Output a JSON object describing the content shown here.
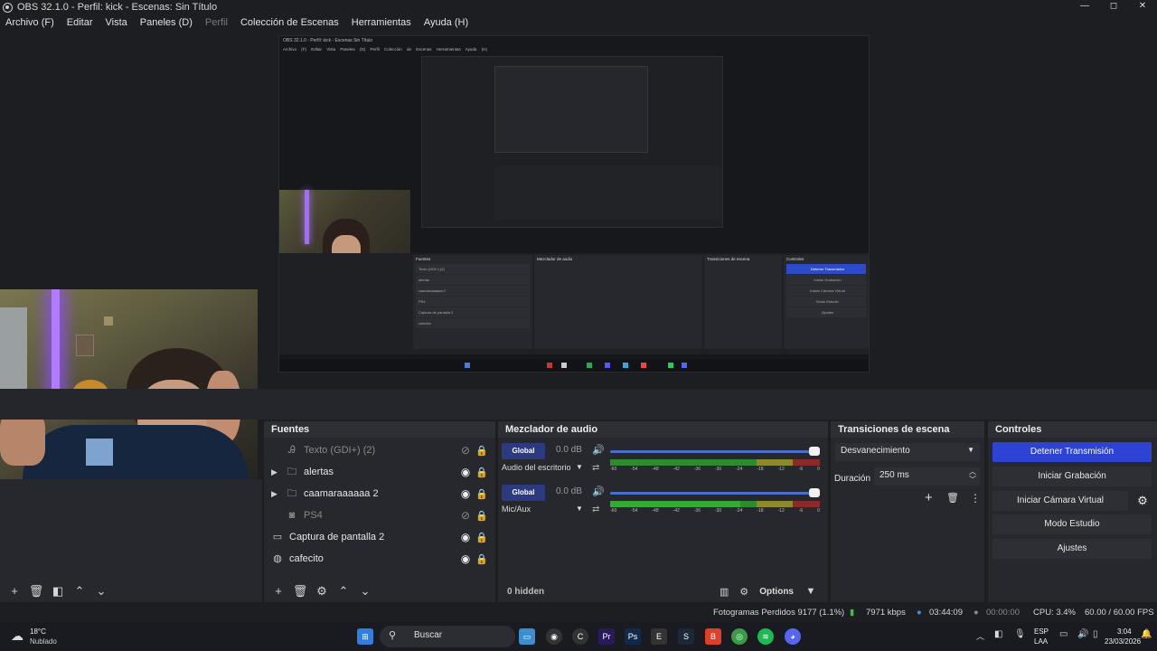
{
  "window": {
    "title": "OBS 32.1.0 - Perfil: kick - Escenas: Sin Título",
    "minimize": "—",
    "maximize": "◻",
    "close": "✕"
  },
  "menu": [
    "Archivo (F)",
    "Editar",
    "Vista",
    "Paneles (D)",
    "Perfil",
    "Colección de Escenas",
    "Herramientas",
    "Ayuda (H)"
  ],
  "nested": {
    "title": "OBS 32.1.0 - Perfil: kick - Escenas Sin Título",
    "menu": "Archivo (F)  Editar  Vista  Paneles (D)  Perfil  Colección de Escenas  Herramientas  Ayuda (H)",
    "docks": {
      "sources_title": "Fuentes",
      "mixer_title": "Mezclador de audio",
      "trans_title": "Transiciones de escena",
      "controls_title": "Controles",
      "sources": [
        "Texto (GDI+) (2)",
        "alertas",
        "caamaraaaaaa 2",
        "PS4",
        "Captura de pantalla 2",
        "cafecito"
      ],
      "controls": [
        "Detener Transmisión",
        "Iniciar Grabación",
        "Iniciar Cámara Virtual",
        "Modo Estudio",
        "Ajustes"
      ]
    }
  },
  "sources": {
    "title": "Fuentes",
    "items": [
      {
        "name": "Texto (GDI+) (2)",
        "icon": "text-icon",
        "expandable": false,
        "visible": false
      },
      {
        "name": "alertas",
        "icon": "folder-icon",
        "expandable": true,
        "visible": true
      },
      {
        "name": "caamaraaaaaa 2",
        "icon": "folder-icon",
        "expandable": true,
        "visible": true
      },
      {
        "name": "PS4",
        "icon": "camera-icon",
        "expandable": false,
        "visible": false
      },
      {
        "name": "Captura de pantalla 2",
        "icon": "monitor-icon",
        "expandable": false,
        "visible": true
      },
      {
        "name": "cafecito",
        "icon": "browser-icon",
        "expandable": false,
        "visible": true
      }
    ]
  },
  "mixer": {
    "title": "Mezclador de audio",
    "channels": [
      {
        "badge": "Global",
        "db": "0.0 dB",
        "name": "Audio del escritorio",
        "volume": 1.0
      },
      {
        "badge": "Global",
        "db": "0.0 dB",
        "name": "Mic/Aux",
        "volume": 1.0
      }
    ],
    "ticks": [
      "-60",
      "-54",
      "-48",
      "-42",
      "-36",
      "-30",
      "-24",
      "-18",
      "-12",
      "-6",
      "0"
    ],
    "hidden": "0 hidden",
    "options": "Options"
  },
  "transitions": {
    "title": "Transiciones de escena",
    "type": "Desvanecimiento",
    "duration_label": "Duración",
    "duration": "250 ms"
  },
  "controls": {
    "title": "Controles",
    "stop_stream": "Detener Transmisión",
    "start_recording": "Iniciar Grabación",
    "start_virtual_cam": "Iniciar Cámara Virtual",
    "studio_mode": "Modo Estudio",
    "settings": "Ajustes"
  },
  "status": {
    "dropped_frames": "Fotogramas Perdidos 9177 (1.1%)",
    "bitrate": "7971 kbps",
    "stream_time": "03:44:09",
    "record_time": "00:00:00",
    "cpu": "CPU: 3.4%",
    "fps": "60.00 / 60.00 FPS"
  },
  "taskbar": {
    "weather_temp": "18°C",
    "weather_desc": "Nublado",
    "search": "Buscar",
    "lang": "ESP",
    "lang2": "LAA",
    "time": "3:04",
    "date": "23/03/2026"
  },
  "colors": {
    "accent_blue": "#2e43d4",
    "global_badge": "#2c3b80"
  }
}
